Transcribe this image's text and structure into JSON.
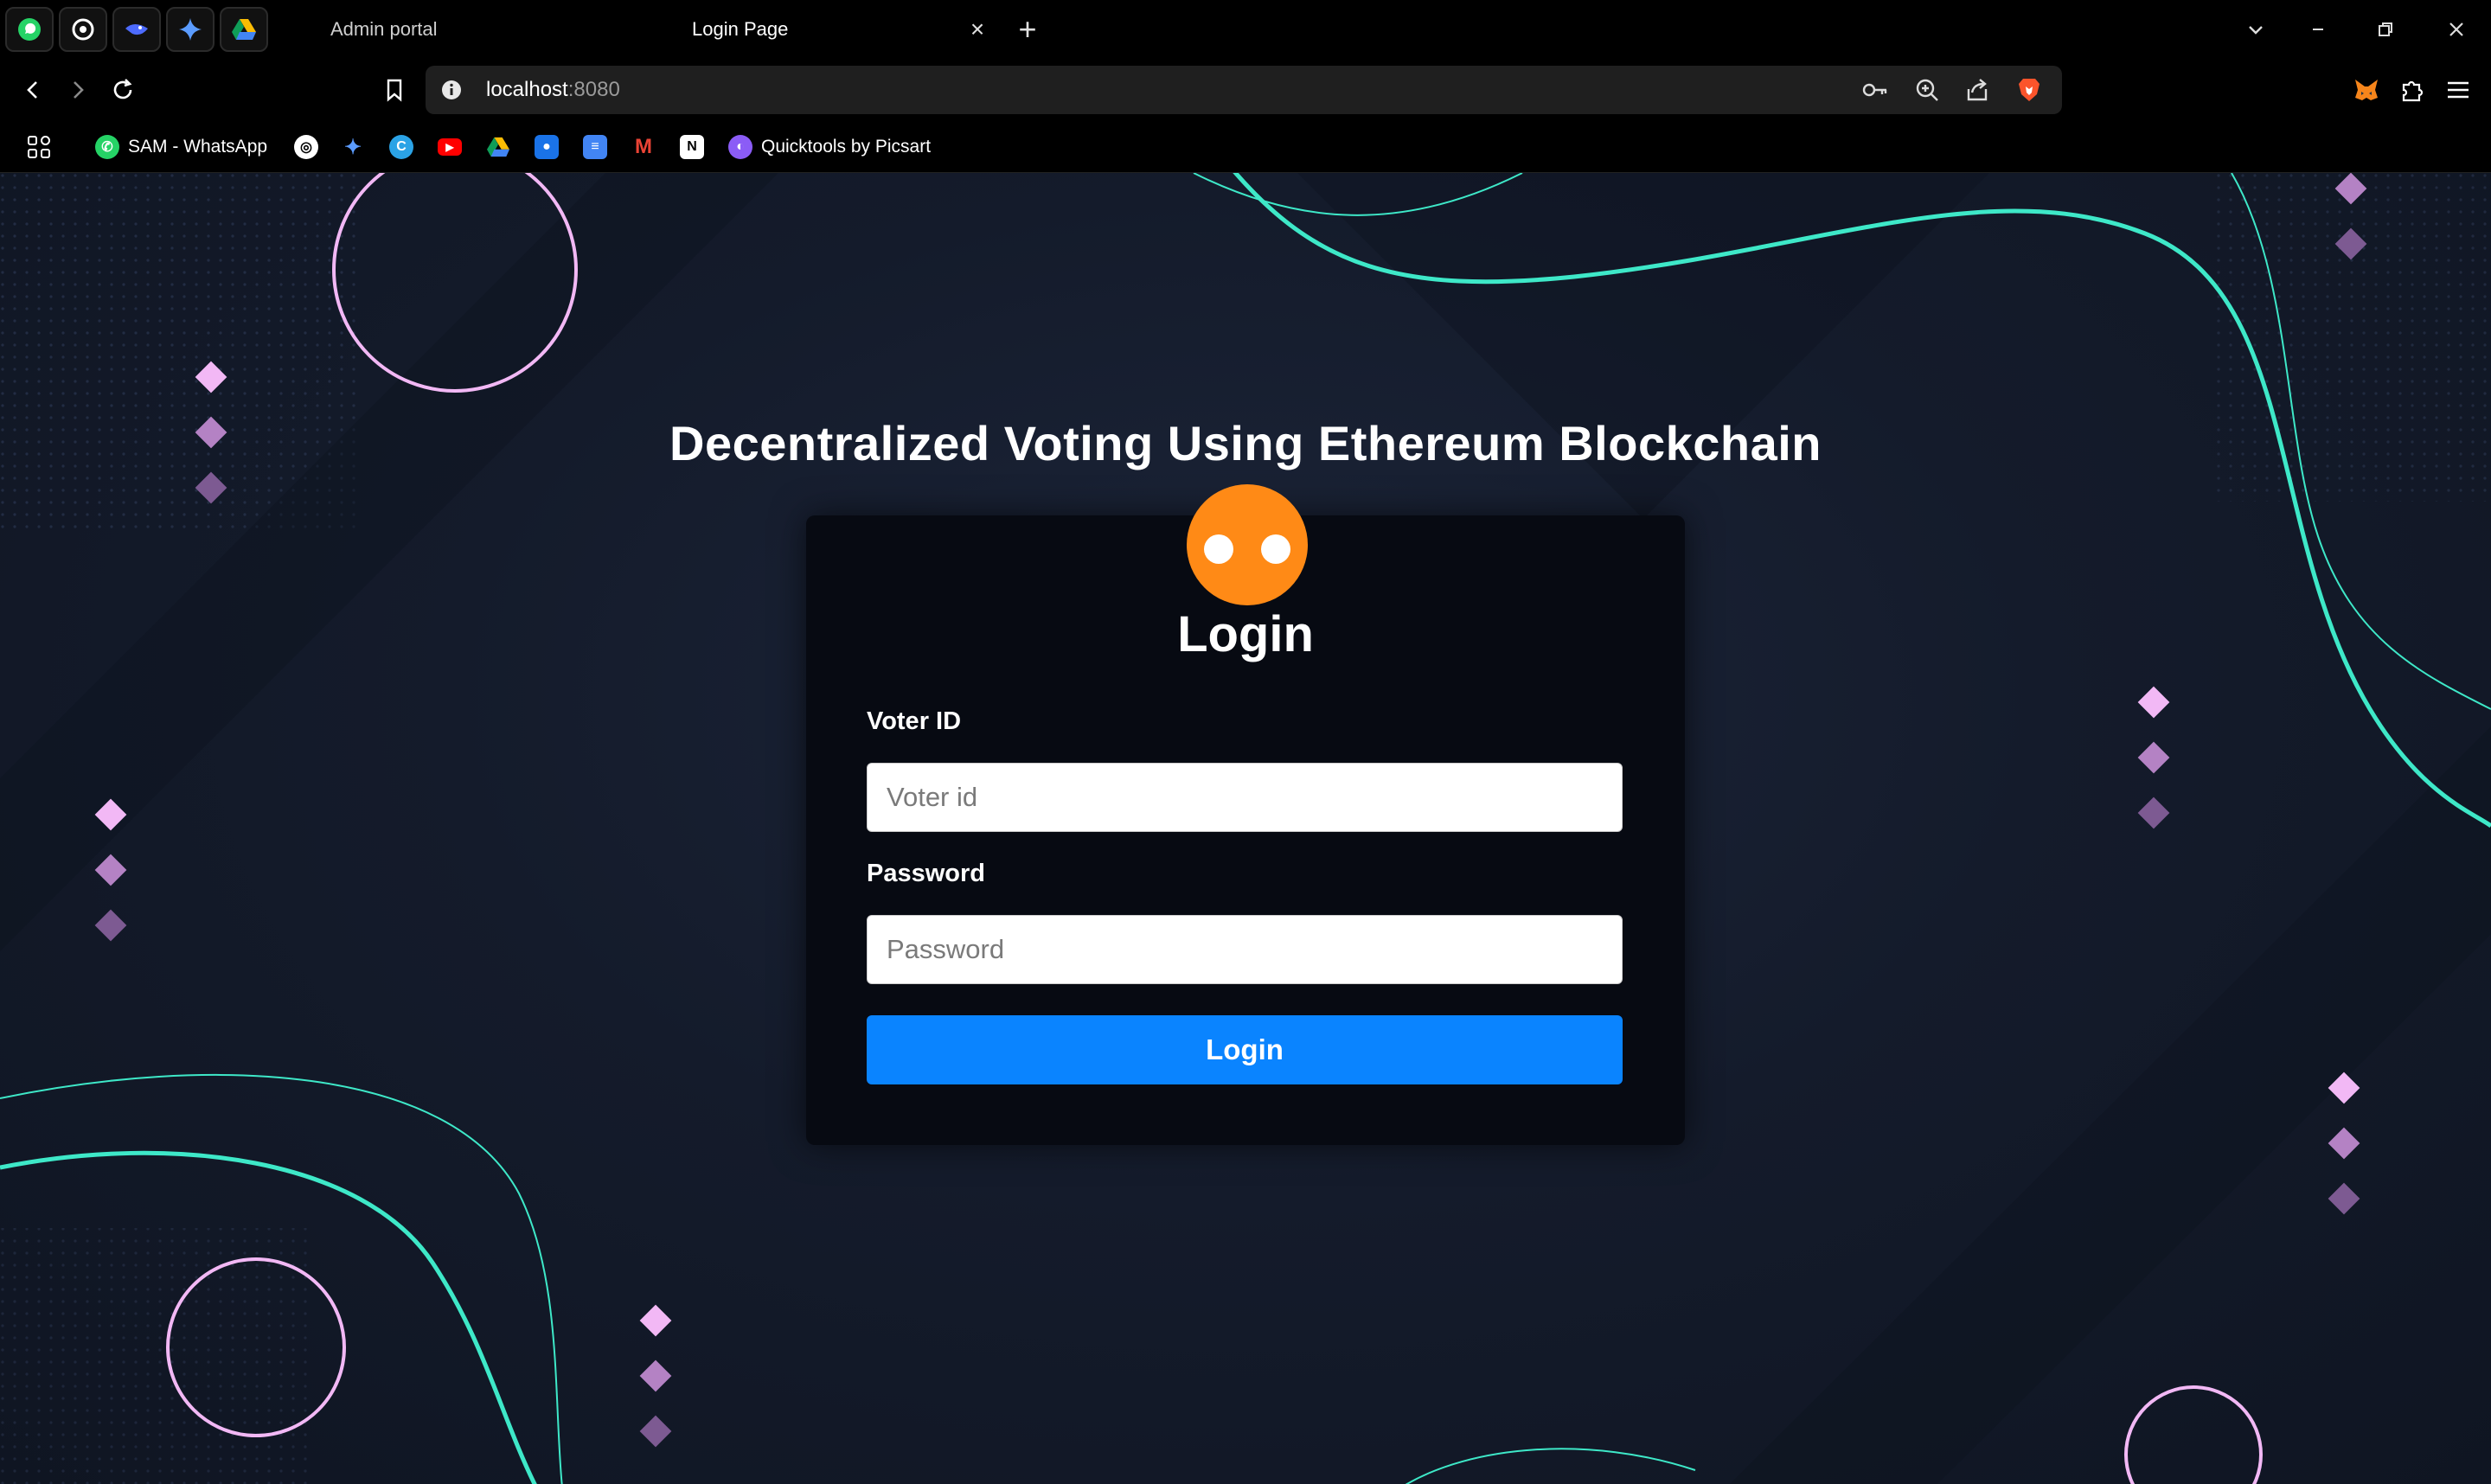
{
  "browser": {
    "tabs": [
      {
        "title": "Admin portal",
        "active": false
      },
      {
        "title": "Login Page",
        "active": true
      }
    ],
    "pinned_tabs": [
      "whatsapp-icon",
      "chatgpt-icon",
      "deepseek-icon",
      "gemini-icon",
      "google-drive-icon"
    ],
    "url": {
      "host": "localhost",
      "port": ":8080"
    },
    "bookmarks": [
      {
        "label": "SAM - WhatsApp",
        "icon": "whatsapp-icon"
      },
      {
        "label": "",
        "icon": "chatgpt-icon"
      },
      {
        "label": "",
        "icon": "gemini-icon"
      },
      {
        "label": "",
        "icon": "canva-icon"
      },
      {
        "label": "",
        "icon": "youtube-icon"
      },
      {
        "label": "",
        "icon": "google-drive-icon"
      },
      {
        "label": "",
        "icon": "contacts-icon"
      },
      {
        "label": "",
        "icon": "google-docs-icon"
      },
      {
        "label": "",
        "icon": "gmail-icon"
      },
      {
        "label": "",
        "icon": "notion-icon"
      },
      {
        "label": "Quicktools by Picsart",
        "icon": "picsart-icon"
      }
    ]
  },
  "page": {
    "heading": "Decentralized Voting Using Ethereum Blockchain",
    "login_card": {
      "title": "Login",
      "voter_id_label": "Voter ID",
      "voter_id_placeholder": "Voter id",
      "voter_id_value": "",
      "password_label": "Password",
      "password_placeholder": "Password",
      "password_value": "",
      "submit_label": "Login"
    }
  },
  "colors": {
    "accent_orange": "#ff8a16",
    "button_blue": "#0a84ff",
    "wave_teal": "#3ee8c8",
    "decor_pink": "#f2b8f5",
    "background": "#141b2b"
  }
}
